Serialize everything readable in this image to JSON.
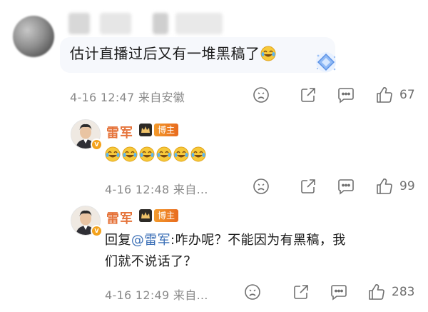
{
  "comment": {
    "text": "估计直播过后又有一堆黑稿了",
    "time": "4-16 12:47",
    "source": "来自安徽",
    "like_count": "67"
  },
  "replies": [
    {
      "name": "雷军",
      "badge": "博主",
      "time": "4-16 12:48",
      "source": "来自…",
      "like_count": "99",
      "emoji_count": 6,
      "emoji_name": "laugh-cry-emoji"
    },
    {
      "name": "雷军",
      "badge": "博主",
      "reply_prefix": "回复",
      "mention": "@雷军",
      "text_line1": ":咋办呢？不能因为有黑稿，我",
      "text_line2": "们就不说话了？",
      "time": "4-16 12:49",
      "source": "来自…",
      "like_count": "283"
    }
  ],
  "icons": {
    "dislike": "sad-face-icon",
    "share": "share-icon",
    "comment": "comment-icon",
    "like": "thumbs-up-icon",
    "crown": "crown-icon",
    "verified": "verified-badge-icon",
    "fan_badge": "diamond-fan-badge-icon"
  },
  "colors": {
    "name": "#e5733a",
    "mention": "#3b6fb6",
    "meta": "#8a8a8a",
    "bozhu_bg": "#ef7f25"
  }
}
